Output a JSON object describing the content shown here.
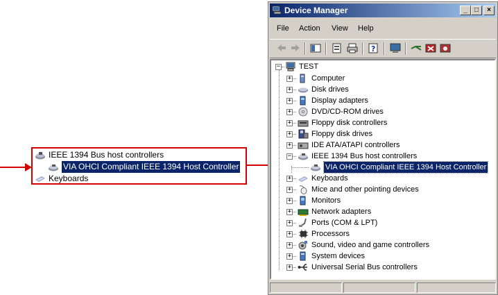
{
  "callout": {
    "rows": [
      {
        "label": "IEEE 1394 Bus host controllers",
        "icon": "firewire-icon"
      },
      {
        "label": "VIA OHCI Compliant IEEE 1394 Host Controller",
        "icon": "firewire-device-icon",
        "selected": true
      },
      {
        "label": "Keyboards",
        "icon": "keyboard-icon"
      }
    ]
  },
  "window": {
    "title": "Device Manager",
    "menu": [
      "File",
      "Action",
      "View",
      "Help"
    ],
    "tree": {
      "root": "TEST",
      "items": [
        {
          "label": "Computer",
          "icon": "computer-icon"
        },
        {
          "label": "Disk drives",
          "icon": "disk-drive-icon"
        },
        {
          "label": "Display adapters",
          "icon": "display-icon"
        },
        {
          "label": "DVD/CD-ROM drives",
          "icon": "cdrom-icon"
        },
        {
          "label": "Floppy disk controllers",
          "icon": "floppy-controller-icon"
        },
        {
          "label": "Floppy disk drives",
          "icon": "floppy-drive-icon"
        },
        {
          "label": "IDE ATA/ATAPI controllers",
          "icon": "ide-controller-icon"
        },
        {
          "label": "IEEE 1394 Bus host controllers",
          "icon": "firewire-icon",
          "expanded": true
        },
        {
          "label": "VIA OHCI Compliant IEEE 1394 Host Controller",
          "icon": "firewire-device-icon",
          "child": true,
          "selected": true
        },
        {
          "label": "Keyboards",
          "icon": "keyboard-icon"
        },
        {
          "label": "Mice and other pointing devices",
          "icon": "mouse-icon"
        },
        {
          "label": "Monitors",
          "icon": "monitor-icon"
        },
        {
          "label": "Network adapters",
          "icon": "network-adapter-icon"
        },
        {
          "label": "Ports (COM & LPT)",
          "icon": "port-icon"
        },
        {
          "label": "Processors",
          "icon": "processor-icon"
        },
        {
          "label": "Sound, video and game controllers",
          "icon": "sound-icon"
        },
        {
          "label": "System devices",
          "icon": "system-device-icon"
        },
        {
          "label": "Universal Serial Bus controllers",
          "icon": "usb-icon"
        }
      ]
    }
  },
  "colors": {
    "accent": "#0a246a",
    "callout_border": "#d40000"
  }
}
